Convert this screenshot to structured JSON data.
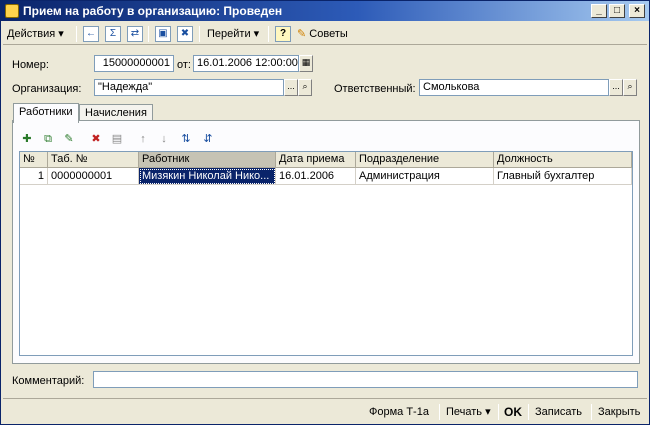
{
  "window": {
    "title": "Прием на работу в организацию: Проведен",
    "minimize": "_",
    "maximize": "□",
    "close": "×"
  },
  "toolbar": {
    "actions_label": "Действия",
    "goto_label": "Перейти",
    "help_label": "?",
    "tips_label": "Советы"
  },
  "form": {
    "number_label": "Номер:",
    "number_value": "15000000001",
    "date_label": "от:",
    "date_value": "16.01.2006 12:00:00",
    "org_label": "Организация:",
    "org_value": "\"Надежда\"",
    "resp_label": "Ответственный:",
    "resp_value": "Смолькова",
    "comment_label": "Комментарий:",
    "comment_value": ""
  },
  "tabs": [
    {
      "label": "Работники"
    },
    {
      "label": "Начисления"
    }
  ],
  "table": {
    "headers": [
      "№",
      "Таб. №",
      "Работник",
      "Дата приема",
      "Подразделение",
      "Должность"
    ],
    "rows": [
      [
        "1",
        "0000000001",
        "Мизякин Николай Нико...",
        "16.01.2006",
        "Администрация",
        "Главный бухгалтер"
      ]
    ]
  },
  "bottom": {
    "form_label": "Форма Т-1а",
    "print_label": "Печать",
    "ok_label": "OK",
    "save_label": "Записать",
    "close_label": "Закрыть"
  }
}
